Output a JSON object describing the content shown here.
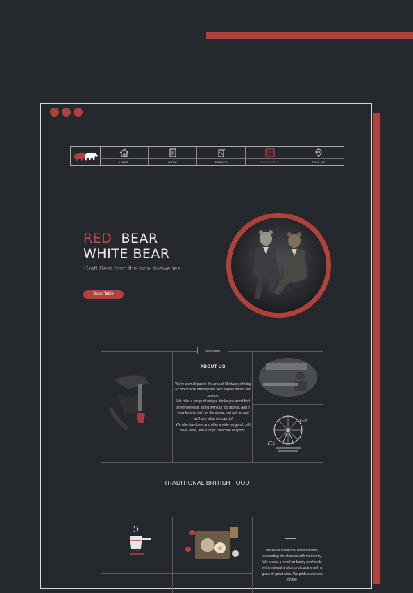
{
  "colors": {
    "accent": "#b1413d",
    "background": "#26292d",
    "text": "#e8e8e8",
    "muted": "#8e8e8e"
  },
  "nav": {
    "items": [
      {
        "label": "HOME",
        "icon": "home-icon"
      },
      {
        "label": "MENU",
        "icon": "menu-book-icon"
      },
      {
        "label": "EVENTS",
        "icon": "events-icon"
      },
      {
        "label": "BOOK TABLE",
        "icon": "book-table-icon",
        "active": true
      },
      {
        "label": "FIND US",
        "icon": "location-pin-icon"
      }
    ]
  },
  "hero": {
    "title_red": "RED",
    "title_white": "BEAR",
    "title_line2": "WHITE  BEAR",
    "subtitle": "Craft Beer from the local breweries",
    "cta": "Book Table"
  },
  "scroll_label": "Scroll Down",
  "about": {
    "title": "ABOUT US",
    "text": "We're a small pub in the area of Medway, offering a comfortable atmosphere with superb drinks and service.\nWe offer a range of unique drinks you won't find anywhere else, along with our top dishes. And if your favorite isn't on the menu, just ask us and we'll see what we can do!\nWe also love beer and offer a wide range of craft beer, wine, and a large collection of spirits."
  },
  "food": {
    "title": "TRADITIONAL BRITISH FOOD",
    "text": "We serve traditional British dishes, decorating the classics with modernity. We create a trend for family weekends with regional and ground cuisine with a glass of great wine. We pride ourselves on the"
  }
}
